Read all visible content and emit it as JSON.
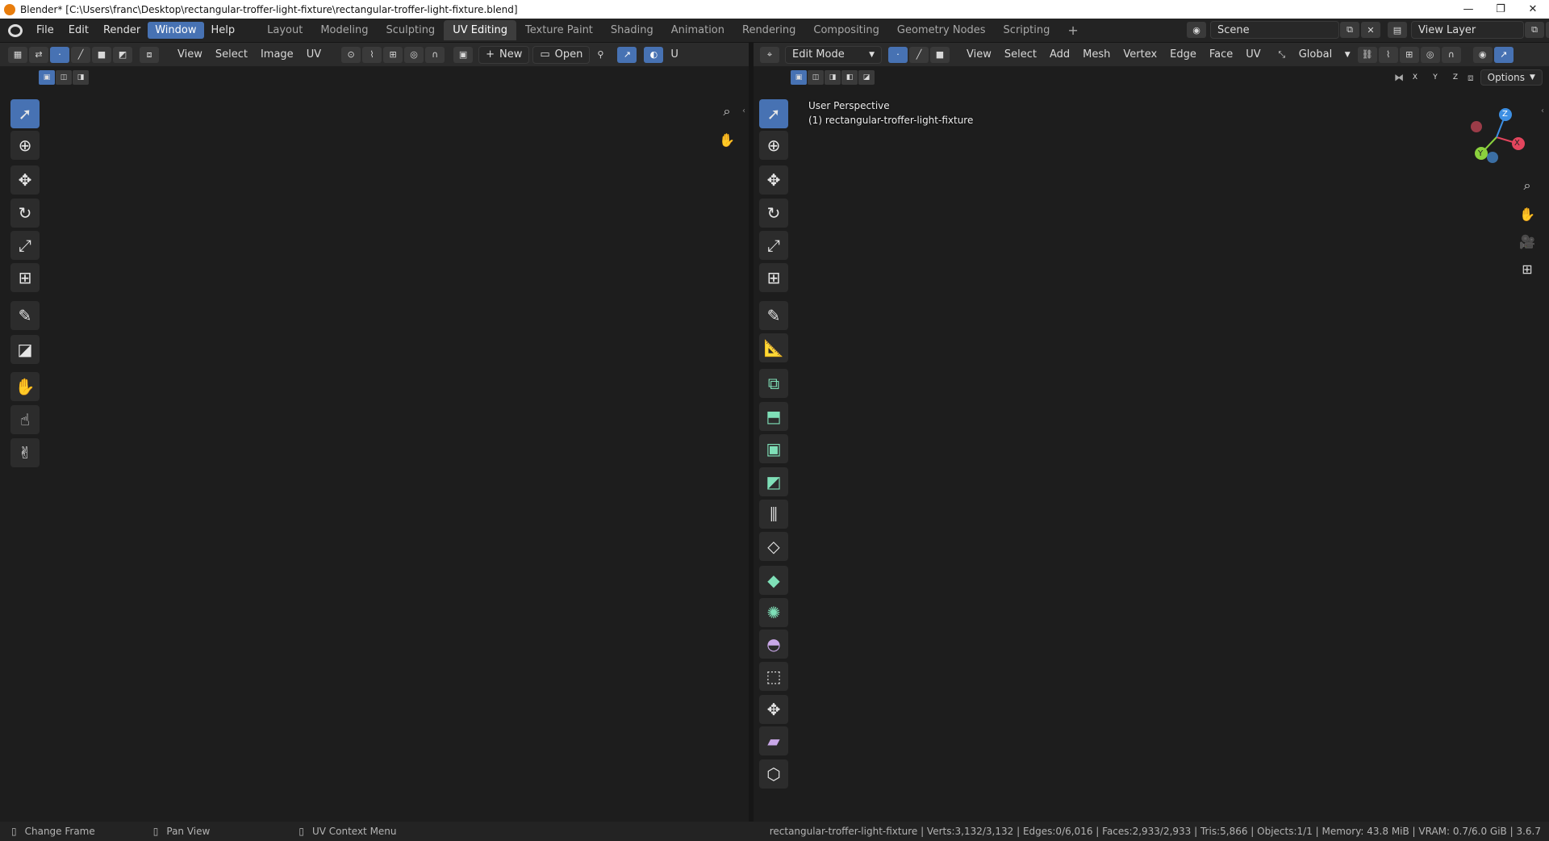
{
  "window": {
    "title": "Blender* [C:\\Users\\franc\\Desktop\\rectangular-troffer-light-fixture\\rectangular-troffer-light-fixture.blend]",
    "minimize": "—",
    "maximize": "❐",
    "close": "✕"
  },
  "menus": [
    "File",
    "Edit",
    "Render",
    "Window",
    "Help"
  ],
  "workspaces": [
    "Layout",
    "Modeling",
    "Sculpting",
    "UV Editing",
    "Texture Paint",
    "Shading",
    "Animation",
    "Rendering",
    "Compositing",
    "Geometry Nodes",
    "Scripting"
  ],
  "add_workspace": "+",
  "scene": {
    "label": "Scene",
    "view_layer": "View Layer"
  },
  "uv_editor": {
    "menus": [
      "View",
      "Select",
      "Image",
      "UV"
    ],
    "new_label": "New",
    "open_label": "Open",
    "cut_label": "U"
  },
  "viewport": {
    "mode": "Edit Mode",
    "menus": [
      "View",
      "Select",
      "Add",
      "Mesh",
      "Vertex",
      "Edge",
      "Face",
      "UV"
    ],
    "orientation": "Global",
    "axes": [
      "X",
      "Y",
      "Z"
    ],
    "options_label": "Options",
    "perspective": "User Perspective",
    "object_label": "(1) rectangular-troffer-light-fixture",
    "gizmo": {
      "x": "X",
      "y": "Y",
      "z": "Z",
      "x_color": "#e3455d",
      "y_color": "#8bd13d",
      "z_color": "#3d8fe3"
    }
  },
  "status": {
    "left": [
      "Change Frame",
      "Pan View",
      "UV Context Menu"
    ],
    "right": "rectangular-troffer-light-fixture | Verts:3,132/3,132 | Edges:0/6,016 | Faces:2,933/2,933 | Tris:5,866 | Objects:1/1 | Memory: 43.8 MiB | VRAM: 0.7/6.0 GiB | 3.6.7"
  },
  "colors": {
    "accent": "#4772b3",
    "selection": "#ff8a1a",
    "uv_fill": "#8a5532",
    "mesh": "#a39590"
  },
  "icons": {
    "uv_tools": [
      "cursor-select-icon",
      "3d-cursor-icon",
      "move-icon",
      "rotate-icon",
      "scale-icon",
      "transform-icon",
      "annotate-icon",
      "rip-icon",
      "grab-icon",
      "relax-icon",
      "pinch-icon"
    ],
    "view3d_tools": [
      "cursor-select-icon",
      "3d-cursor-icon",
      "move-icon",
      "rotate-icon",
      "scale-icon",
      "transform-icon",
      "annotate-icon",
      "measure-icon",
      "add-cube-icon",
      "extrude-icon",
      "inset-icon",
      "bevel-icon",
      "loop-cut-icon",
      "knife-icon",
      "poly-build-icon",
      "spin-icon",
      "smooth-icon",
      "edge-slide-icon",
      "shrink-fatten-icon",
      "shear-icon",
      "rip-region-icon"
    ]
  }
}
